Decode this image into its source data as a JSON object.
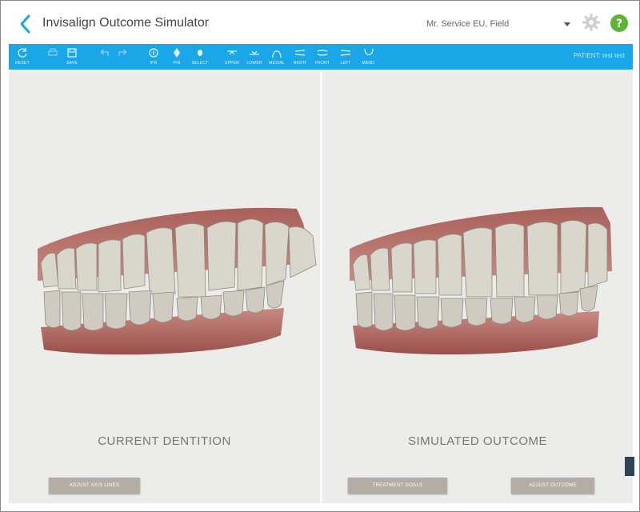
{
  "app": {
    "title": "Invisalign Outcome Simulator",
    "user": "Mr. Service EU, Field"
  },
  "toolbar": {
    "accent_color": "#1aa7e8",
    "patient_label": "PATIENT: test test",
    "tools": [
      {
        "name": "reset",
        "label": "RESET",
        "icon": "reset-icon"
      },
      {
        "name": "save-print",
        "label": "",
        "icon": "printer-icon"
      },
      {
        "name": "save",
        "label": "SAVE",
        "icon": "save-icon"
      },
      {
        "name": "undo",
        "label": "",
        "icon": "undo-icon"
      },
      {
        "name": "redo",
        "label": "",
        "icon": "redo-icon"
      },
      {
        "name": "ipr",
        "label": "IPR",
        "icon": "ipr-icon"
      },
      {
        "name": "pin",
        "label": "PIN",
        "icon": "pin-icon"
      },
      {
        "name": "select",
        "label": "SELECT",
        "icon": "select-icon"
      },
      {
        "name": "upper",
        "label": "UPPER",
        "icon": "upper-arch-icon"
      },
      {
        "name": "lower",
        "label": "LOWER",
        "icon": "lower-arch-icon"
      },
      {
        "name": "mesial",
        "label": "MESIAL",
        "icon": "mesial-icon"
      },
      {
        "name": "right",
        "label": "RIGHT",
        "icon": "right-view-icon"
      },
      {
        "name": "front",
        "label": "FRONT",
        "icon": "front-view-icon"
      },
      {
        "name": "left",
        "label": "LEFT",
        "icon": "left-view-icon"
      },
      {
        "name": "lower-arch",
        "label": "MAND.",
        "icon": "mandible-icon"
      }
    ]
  },
  "panels": {
    "left": {
      "label": "CURRENT DENTITION",
      "buttons": [
        "ADJUST AXIS LINES"
      ]
    },
    "right": {
      "label": "SIMULATED OUTCOME",
      "buttons": [
        "TREATMENT GOALS",
        "ADJUST OUTCOME"
      ]
    }
  }
}
